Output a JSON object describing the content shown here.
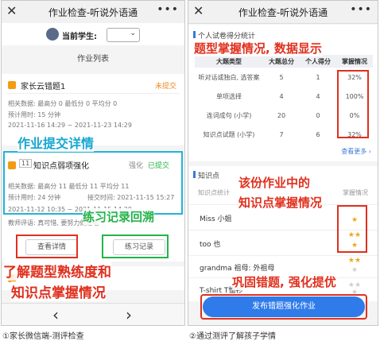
{
  "left": {
    "title": "作业检查-听说外语通",
    "student_label": "当前学生:",
    "section_title": "作业列表",
    "hw1": {
      "name": "家长云错题1",
      "status": "未提交",
      "stats": "相关数据:  最高分  0   最低分  0   平均分  0",
      "time": "预计用时: 15 分钟",
      "range": "2021-11-16 14:29 ~ 2021-11-23 14:29"
    },
    "hw2": {
      "num": "11",
      "name": "知识点弱项强化",
      "type": "强化",
      "status": "已提交",
      "stats": "相关数据:  最高分  11   最低分  11   平均分  11",
      "time": "预计用时: 24 分钟",
      "submit": "接交时间: 2021-11-15 15:27",
      "range": "2021-11-12 10:35 ~ 2021-11-15 14:29",
      "comment": "教师评语: 真可惜, 要努力做题哦!",
      "btn_detail": "查看详情",
      "btn_practice": "练习记录"
    },
    "nav_back": "‹",
    "nav_fwd": "›",
    "caption": "①家长微信端-测评检查"
  },
  "right": {
    "title": "作业检查-听说外语通",
    "score_section": "个人试卷得分统计",
    "table_headers": [
      "大题类型",
      "大题总分",
      "个人得分",
      "掌握情况"
    ],
    "rows": [
      [
        "听对话或独白, 选答案",
        "5",
        "1",
        "32%"
      ],
      [
        "单项选择",
        "4",
        "4",
        "100%"
      ],
      [
        "连词成句 (小学)",
        "20",
        "0",
        "0%"
      ],
      [
        "知识点试题 (小学)",
        "7",
        "6",
        "32%"
      ]
    ],
    "see_more": "查看更多 ›",
    "knowledge_section": "知识点",
    "kp_header_left": "知识点统计",
    "kp_header_right": "掌握情况",
    "kp_items": [
      {
        "label": "Miss 小姐",
        "stars": 3
      },
      {
        "label": "too 也",
        "stars": 3
      },
      {
        "label": "grandma 祖母: 外祖母",
        "stars": 0
      },
      {
        "label": "T-shirt T恤衫",
        "stars": 0
      }
    ],
    "publish_btn": "发布错题强化作业",
    "caption": "②通过测评了解孩子学情"
  },
  "annotations": {
    "a1": "作业提交详情",
    "a2": "练习记录回溯",
    "a3": "了解题型熟练度和",
    "a4": "知识点掌握情况",
    "a5": "题型掌握情况, 数据显示",
    "a6": "该份作业中的",
    "a7": "知识点掌握情况",
    "a8": "巩固错题, 强化提优"
  }
}
